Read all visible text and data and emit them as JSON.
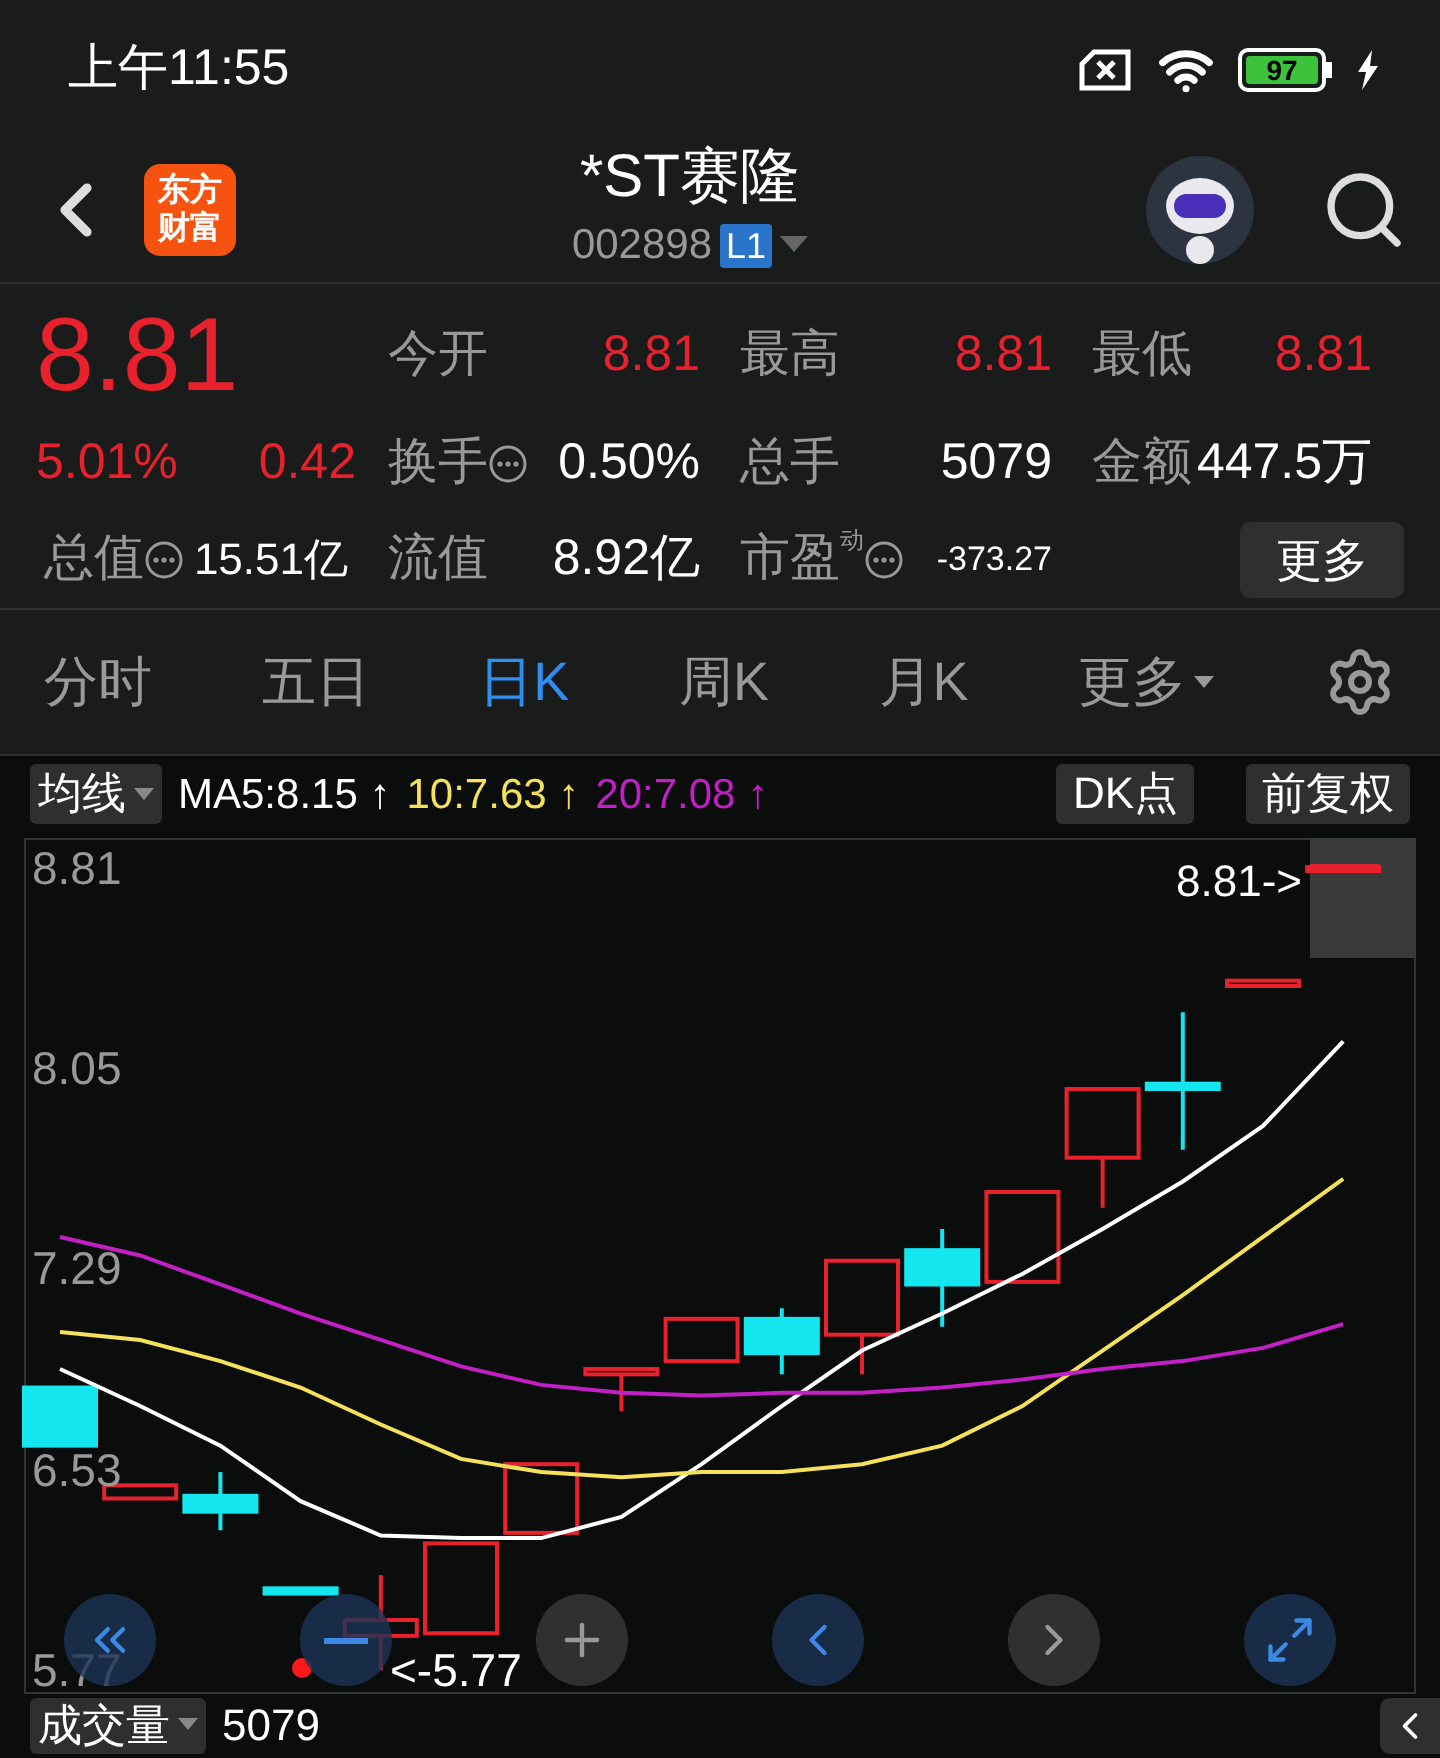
{
  "status_bar": {
    "time": "上午11:55",
    "battery": "97"
  },
  "header": {
    "logo": "东方财富",
    "title": "*ST赛隆",
    "code": "002898",
    "level_badge": "L1"
  },
  "quote": {
    "price": "8.81",
    "change_pct": "5.01%",
    "change": "0.42",
    "fields": [
      {
        "label": "今开",
        "value": "8.81",
        "color": "#e8212c"
      },
      {
        "label": "最高",
        "value": "8.81",
        "color": "#e8212c"
      },
      {
        "label": "最低",
        "value": "8.81",
        "color": "#e8212c"
      },
      {
        "label": "换手",
        "info": true,
        "value": "0.50%",
        "color": "#ffffff"
      },
      {
        "label": "总手",
        "value": "5079",
        "color": "#ffffff"
      },
      {
        "label": "金额",
        "value": "447.5万",
        "color": "#ffffff"
      },
      {
        "label": "总值",
        "info": true,
        "value": "15.51亿",
        "color": "#ffffff"
      },
      {
        "label": "流值",
        "value": "8.92亿",
        "color": "#ffffff"
      },
      {
        "label": "市盈",
        "sup": "动",
        "info": true,
        "value": "-373.27",
        "color": "#ffffff"
      }
    ],
    "more_button": "更多"
  },
  "tabs": [
    {
      "label": "分时",
      "selected": false
    },
    {
      "label": "五日",
      "selected": false
    },
    {
      "label": "日K",
      "selected": true
    },
    {
      "label": "周K",
      "selected": false
    },
    {
      "label": "月K",
      "selected": false
    },
    {
      "label": "更多",
      "selected": false,
      "dropdown": true
    }
  ],
  "indicator_bar": {
    "selector": "均线",
    "ma": [
      {
        "text": "MA5:8.15",
        "arrow": "↑",
        "color": "#ffffff"
      },
      {
        "text": "10:7.63",
        "arrow": "↑",
        "color": "#f5e15a"
      },
      {
        "text": "20:7.08",
        "arrow": "↑",
        "color": "#c21fc4"
      }
    ],
    "dk_button": "DK点",
    "adjust_button": "前复权"
  },
  "chart": {
    "last_price_label": "8.81->",
    "low_label": "<-5.77",
    "chart_data": {
      "type": "line",
      "ylim": [
        5.68,
        8.92
      ],
      "yticks": [
        {
          "value": 8.81,
          "label": "8.81"
        },
        {
          "value": 8.05,
          "label": "8.05"
        },
        {
          "value": 7.29,
          "label": "7.29"
        },
        {
          "value": 6.53,
          "label": "6.53"
        },
        {
          "value": 5.77,
          "label": "5.77"
        }
      ],
      "series": [
        {
          "color": "#ffffff",
          "values": [
            6.91,
            6.77,
            6.62,
            6.41,
            6.28,
            6.27,
            6.27,
            6.35,
            6.55,
            6.77,
            6.98,
            7.12,
            7.27,
            7.44,
            7.62,
            7.83,
            8.15
          ]
        },
        {
          "color": "#f5e15a",
          "values": [
            7.05,
            7.02,
            6.94,
            6.84,
            6.7,
            6.57,
            6.52,
            6.5,
            6.52,
            6.52,
            6.55,
            6.62,
            6.77,
            6.98,
            7.19,
            7.41,
            7.63
          ]
        },
        {
          "color": "#c21fc4",
          "values": [
            7.41,
            7.34,
            7.23,
            7.12,
            7.02,
            6.92,
            6.85,
            6.82,
            6.81,
            6.82,
            6.82,
            6.84,
            6.87,
            6.91,
            6.94,
            6.99,
            7.08
          ]
        }
      ]
    }
  },
  "volume_bar": {
    "selector": "成交量",
    "value": "5079"
  }
}
